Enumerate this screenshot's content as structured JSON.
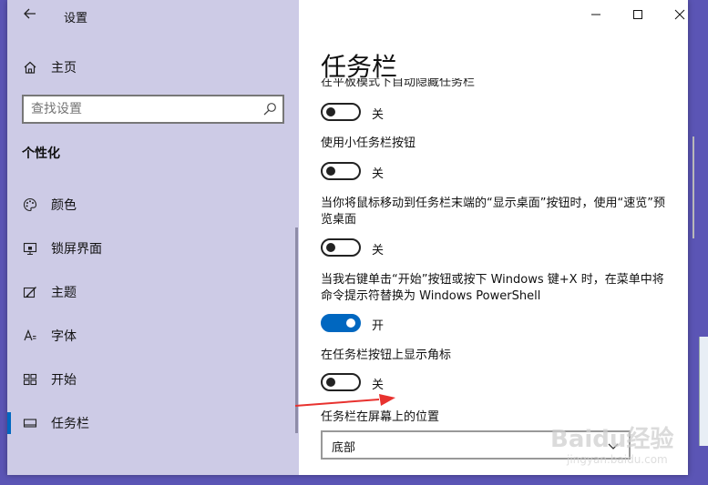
{
  "window": {
    "title": "设置"
  },
  "sidebar": {
    "home": {
      "label": "主页",
      "icon": "home-icon"
    },
    "search": {
      "placeholder": "查找设置",
      "value": ""
    },
    "section": "个性化",
    "items": [
      {
        "label": "颜色",
        "icon": "palette-icon",
        "active": false
      },
      {
        "label": "锁屏界面",
        "icon": "monitor-lock-icon",
        "active": false
      },
      {
        "label": "主题",
        "icon": "theme-brush-icon",
        "active": false
      },
      {
        "label": "字体",
        "icon": "font-icon",
        "active": false
      },
      {
        "label": "开始",
        "icon": "start-tiles-icon",
        "active": false
      },
      {
        "label": "任务栏",
        "icon": "taskbar-icon",
        "active": true
      }
    ]
  },
  "main": {
    "title": "任务栏",
    "cut_off_label": "在平板模式下自动隐藏任务栏",
    "settings": [
      {
        "label": "",
        "state_label": "关",
        "on": false
      },
      {
        "label": "使用小任务栏按钮",
        "state_label": "关",
        "on": false
      },
      {
        "label": "当你将鼠标移动到任务栏末端的“显示桌面”按钮时，使用“速览”预览桌面",
        "state_label": "关",
        "on": false
      },
      {
        "label": "当我右键单击“开始”按钮或按下 Windows 键+X 时，在菜单中将命令提示符替换为 Windows PowerShell",
        "state_label": "开",
        "on": true
      },
      {
        "label": "在任务栏按钮上显示角标",
        "state_label": "关",
        "on": false
      }
    ],
    "position": {
      "label": "任务栏在屏幕上的位置",
      "value": "底部"
    }
  },
  "watermark": {
    "brand": "Baidu经验",
    "url": "jingyan.baidu.com"
  },
  "colors": {
    "accent": "#0067c0",
    "sidebar_bg": "#cdcbe6",
    "arrow": "#e8322f"
  }
}
